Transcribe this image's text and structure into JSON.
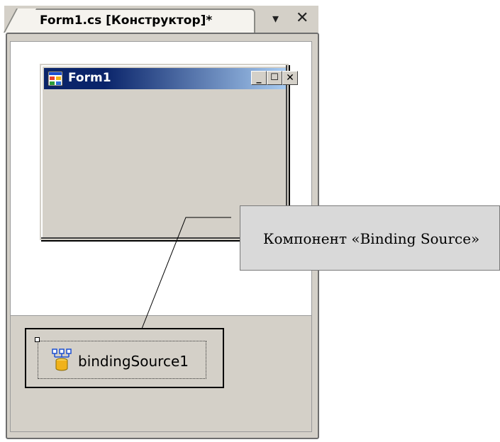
{
  "tab": {
    "title": "Form1.cs [Конструктор]*",
    "dropdown_glyph": "▾",
    "close_glyph": "✕"
  },
  "form": {
    "title": "Form1",
    "minimize_glyph": "_",
    "maximize_glyph": "☐",
    "close_glyph": "✕",
    "icon": "form-window-icon"
  },
  "tray": {
    "component_label": "bindingSource1",
    "component_icon": "binding-source-icon"
  },
  "callout": {
    "label": "Компонент «Binding Source»"
  },
  "colors": {
    "titlebar_start": "#0a246a",
    "titlebar_end": "#a6caf0",
    "surface": "#d4d0c8"
  }
}
